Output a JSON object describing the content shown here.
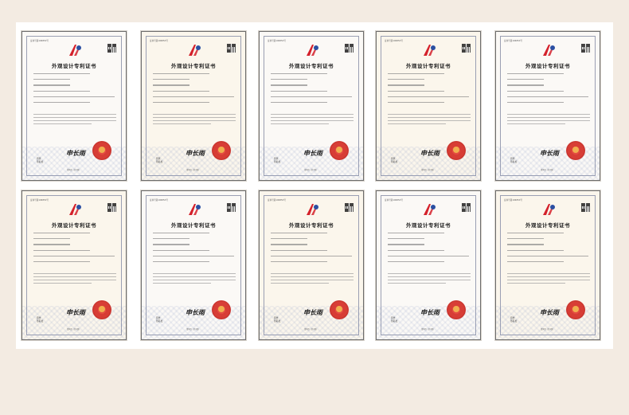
{
  "colors": {
    "page_background": "#f3ebe2",
    "board_background": "#ffffff",
    "seal_red": "#d52a22",
    "logo_red": "#d4212b",
    "logo_blue": "#2b4fa2"
  },
  "certificates": [
    {
      "serial": "证书号第10685X号",
      "title": "外观设计专利证书",
      "signature": "申长雨",
      "page": "第1页（共1页）",
      "tone": "cool"
    },
    {
      "serial": "证书号第10685X号",
      "title": "外观设计专利证书",
      "signature": "申长雨",
      "page": "第1页（共1页）",
      "tone": "warm"
    },
    {
      "serial": "证书号第10685X号",
      "title": "外观设计专利证书",
      "signature": "申长雨",
      "page": "第1页（共1页）",
      "tone": "cool"
    },
    {
      "serial": "证书号第10685X号",
      "title": "外观设计专利证书",
      "signature": "申长雨",
      "page": "第1页（共1页）",
      "tone": "warm"
    },
    {
      "serial": "证书号第10685X号",
      "title": "外观设计专利证书",
      "signature": "申长雨",
      "page": "第1页（共1页）",
      "tone": "cool"
    },
    {
      "serial": "证书号第10685X号",
      "title": "外观设计专利证书",
      "signature": "申长雨",
      "page": "第1页（共1页）",
      "tone": "warm"
    },
    {
      "serial": "证书号第10685X号",
      "title": "外观设计专利证书",
      "signature": "申长雨",
      "page": "第1页（共1页）",
      "tone": "cool"
    },
    {
      "serial": "证书号第10685X号",
      "title": "外观设计专利证书",
      "signature": "申长雨",
      "page": "第1页（共1页）",
      "tone": "warm"
    },
    {
      "serial": "证书号第10685X号",
      "title": "外观设计专利证书",
      "signature": "申长雨",
      "page": "第1页（共1页）",
      "tone": "cool"
    },
    {
      "serial": "证书号第10685X号",
      "title": "外观设计专利证书",
      "signature": "申长雨",
      "page": "第1页（共1页）",
      "tone": "warm"
    }
  ],
  "bureau_label": "局长\n签名栏"
}
